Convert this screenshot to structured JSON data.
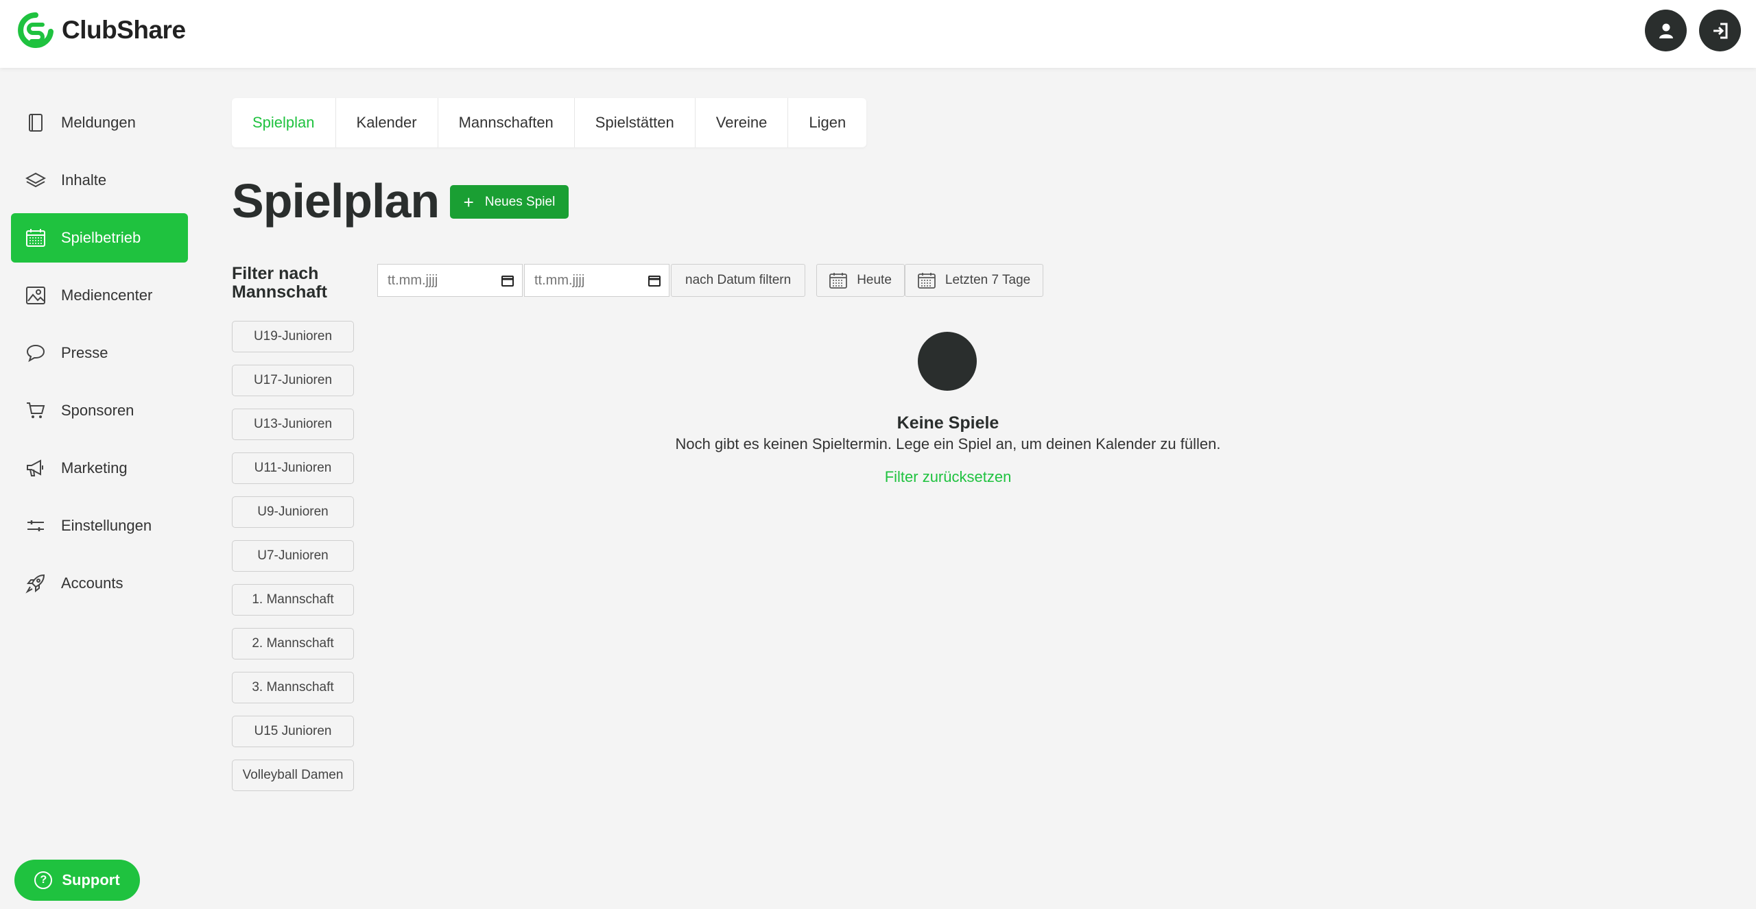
{
  "app": {
    "name": "ClubShare",
    "brand_color": "#1fc23f",
    "dark_color": "#2a2e2d"
  },
  "header": {
    "user_icon": "user-icon",
    "logout_icon": "logout-icon"
  },
  "sidebar": {
    "items": [
      {
        "label": "Meldungen",
        "icon": "book-icon"
      },
      {
        "label": "Inhalte",
        "icon": "layers-icon"
      },
      {
        "label": "Spielbetrieb",
        "icon": "calendar-icon",
        "active": true
      },
      {
        "label": "Mediencenter",
        "icon": "image-icon"
      },
      {
        "label": "Presse",
        "icon": "speech-bubble-icon"
      },
      {
        "label": "Sponsoren",
        "icon": "cart-icon"
      },
      {
        "label": "Marketing",
        "icon": "megaphone-icon"
      },
      {
        "label": "Einstellungen",
        "icon": "sliders-icon"
      },
      {
        "label": "Accounts",
        "icon": "rocket-icon"
      }
    ]
  },
  "support": {
    "label": "Support"
  },
  "tabs": [
    {
      "label": "Spielplan",
      "active": true
    },
    {
      "label": "Kalender"
    },
    {
      "label": "Mannschaften"
    },
    {
      "label": "Spielstätten"
    },
    {
      "label": "Vereine"
    },
    {
      "label": "Ligen"
    }
  ],
  "page": {
    "title": "Spielplan",
    "new_button": "Neues Spiel"
  },
  "filter": {
    "heading": "Filter nach Mannschaft",
    "teams": [
      "U19-Junioren",
      "U17-Junioren",
      "U13-Junioren",
      "U11-Junioren",
      "U9-Junioren",
      "U7-Junioren",
      "1. Mannschaft",
      "2. Mannschaft",
      "3. Mannschaft",
      "U15 Junioren",
      "Volleyball Damen"
    ],
    "date_from_placeholder": "tt.mm.jjjj",
    "date_to_placeholder": "tt.mm.jjjj",
    "date_filter_label": "nach Datum filtern",
    "today_label": "Heute",
    "last7_label": "Letzten 7 Tage"
  },
  "empty_state": {
    "title": "Keine Spiele",
    "text": "Noch gibt es keinen Spieltermin. Lege ein Spiel an, um deinen Kalender zu füllen.",
    "reset_link": "Filter zurücksetzen"
  }
}
